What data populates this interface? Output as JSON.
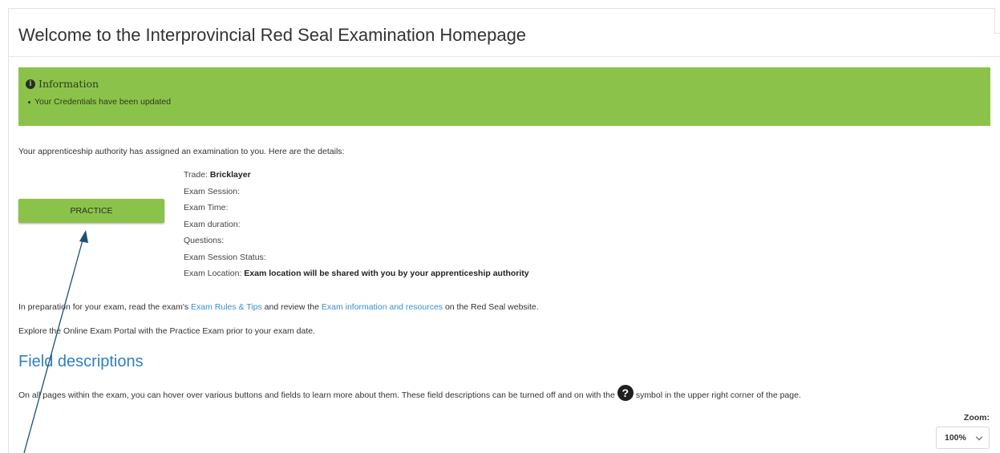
{
  "page": {
    "title": "Welcome to the Interprovincial Red Seal Examination Homepage"
  },
  "info_box": {
    "heading": "Information",
    "items": [
      "Your Credentials have been updated"
    ],
    "color": "#8bc34a"
  },
  "assigned_text": "Your apprenticeship authority has assigned an examination to you. Here are the details:",
  "practice_button": {
    "label": "PRACTICE"
  },
  "details": {
    "trade_label": "Trade: ",
    "trade_value": "Bricklayer",
    "exam_session_label": "Exam Session:",
    "exam_time_label": "Exam Time:",
    "exam_duration_label": "Exam duration:",
    "questions_label": "Questions:",
    "exam_session_status_label": "Exam Session Status:",
    "exam_location_label": "Exam Location: ",
    "exam_location_value": "Exam location will be shared with you by your apprenticeship authority"
  },
  "prep_text": {
    "part1": "In preparation for your exam, read the exam's ",
    "link1": "Exam Rules & Tips",
    "part2": " and review the ",
    "link2": "Exam information and resources",
    "part3": " on the Red Seal website."
  },
  "explore_text": "Explore the Online Exam Portal with the Practice Exam prior to your exam date.",
  "field_descriptions": {
    "heading": "Field descriptions",
    "text_before": "On all pages within the exam, you can hover over various buttons and fields to learn more about them. These field descriptions can be turned off and on with the",
    "text_after": "symbol in the upper right corner of the page.",
    "icon": "question-circle-icon"
  },
  "zoom": {
    "label": "Zoom:",
    "value": "100%"
  },
  "colors": {
    "accent_green": "#8bc34a",
    "link_blue": "#3a8fd0",
    "heading_blue": "#2f7fc1",
    "annotation_arrow": "#1f4e79"
  }
}
